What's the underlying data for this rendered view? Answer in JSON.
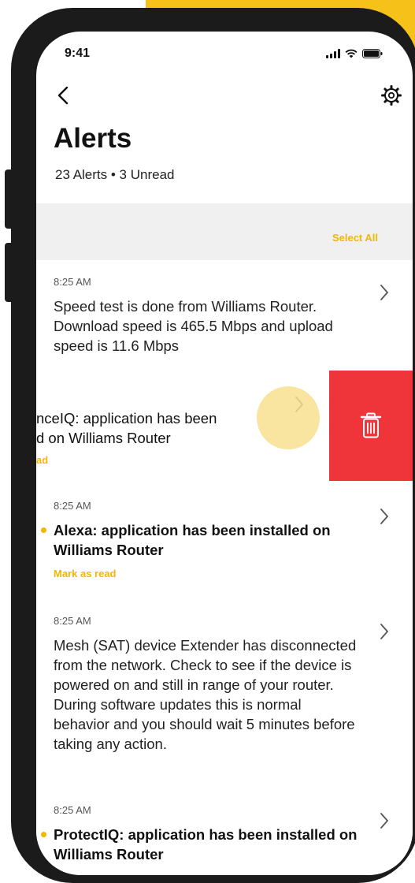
{
  "status_bar": {
    "time": "9:41"
  },
  "header": {
    "title": "Alerts",
    "subtitle": "23 Alerts • 3 Unread"
  },
  "toolbar": {
    "select_all": "Select All"
  },
  "alerts": [
    {
      "time": "8:25 AM",
      "message": "Speed test is done from Williams Router. Download speed is 465.5 Mbps and upload speed is 11.6 Mbps",
      "unread": false
    },
    {
      "time": "",
      "message_line1": "nceIQ: application has been",
      "message_line2": "d on Williams Router",
      "mark_as_read": "ad",
      "unread": true,
      "swiped": true
    },
    {
      "time": "8:25 AM",
      "message": "Alexa: application has been installed on Williams Router",
      "mark_as_read": "Mark as read",
      "unread": true
    },
    {
      "time": "8:25 AM",
      "message": "Mesh (SAT) device Extender has disconnected from the network. Check to see if the device is powered on and still in range of your router. During software updates this is normal behavior and you should wait 5 minutes before taking any action.",
      "unread": false
    },
    {
      "time": "8:25 AM",
      "message": "ProtectIQ: application has been installed on Williams Router",
      "unread": true
    }
  ],
  "colors": {
    "accent": "#f0b800",
    "delete": "#f0353a",
    "phone_frame": "#1b1b1b"
  },
  "icons": {
    "back": "chevron-left-icon",
    "settings": "gear-icon",
    "row_action": "chevron-right-icon",
    "delete": "trash-icon"
  }
}
